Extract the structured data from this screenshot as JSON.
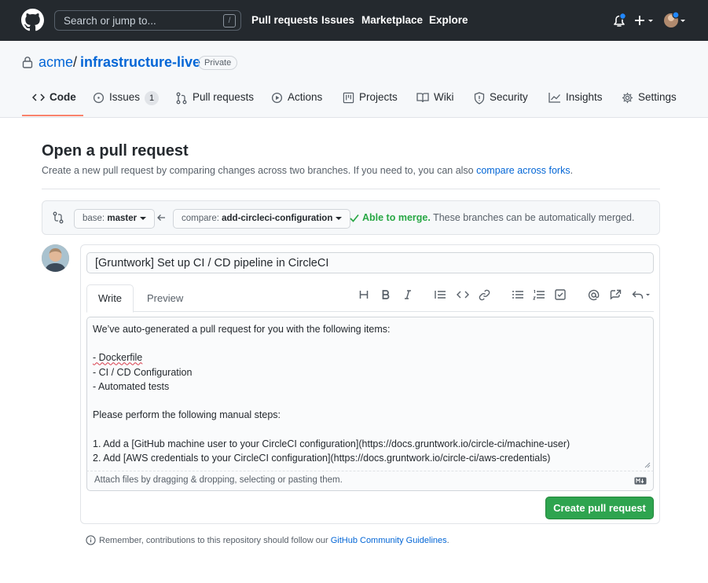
{
  "header": {
    "search_placeholder": "Search or jump to...",
    "search_shortcut": "/",
    "nav": [
      "Pull requests",
      "Issues",
      "Marketplace",
      "Explore"
    ]
  },
  "repo": {
    "owner": "acme",
    "separator": "/",
    "name": "infrastructure-live",
    "visibility": "Private"
  },
  "tabs": [
    {
      "label": "Code",
      "icon": "code-icon",
      "active": true
    },
    {
      "label": "Issues",
      "icon": "issue-opened-icon",
      "count": "1"
    },
    {
      "label": "Pull requests",
      "icon": "git-pull-request-icon"
    },
    {
      "label": "Actions",
      "icon": "play-icon"
    },
    {
      "label": "Projects",
      "icon": "project-icon"
    },
    {
      "label": "Wiki",
      "icon": "book-icon"
    },
    {
      "label": "Security",
      "icon": "shield-icon"
    },
    {
      "label": "Insights",
      "icon": "graph-icon"
    },
    {
      "label": "Settings",
      "icon": "gear-icon"
    }
  ],
  "page": {
    "title": "Open a pull request",
    "subtitle": "Create a new pull request by comparing changes across two branches. If you need to, you can also ",
    "subtitle_link": "compare across forks",
    "subtitle_end": "."
  },
  "compare": {
    "base_label": "base:",
    "base_value": "master",
    "compare_label": "compare:",
    "compare_value": "add-circleci-configuration",
    "merge_status": "Able to merge.",
    "merge_detail": " These branches can be automatically merged."
  },
  "pr_form": {
    "title_value": "[Gruntwork] Set up CI / CD pipeline in CircleCI",
    "tab_write": "Write",
    "tab_preview": "Preview",
    "body_lines": [
      "We’ve auto-generated a pull request for you with the following items:",
      "",
      "- Dockerfile",
      "- CI / CD Configuration",
      "- Automated tests",
      "",
      "Please perform the following manual steps:",
      "",
      "1. Add a [GitHub machine user to your CircleCI configuration](https://docs.gruntwork.io/circle-ci/machine-user)",
      "2. Add [AWS credentials to your CircleCI configuration](https://docs.gruntwork.io/circle-ci/aws-credentials)"
    ],
    "attach_hint": "Attach files by dragging & dropping, selecting or pasting them.",
    "submit_label": "Create pull request"
  },
  "footer": {
    "notice": "Remember, contributions to this repository should follow our ",
    "link": "GitHub Community Guidelines",
    "end": "."
  },
  "colors": {
    "header_bg": "#24292e",
    "link": "#0366d6",
    "success": "#28a745",
    "button_green": "#2ea44f",
    "tab_underline": "#f9826c"
  }
}
